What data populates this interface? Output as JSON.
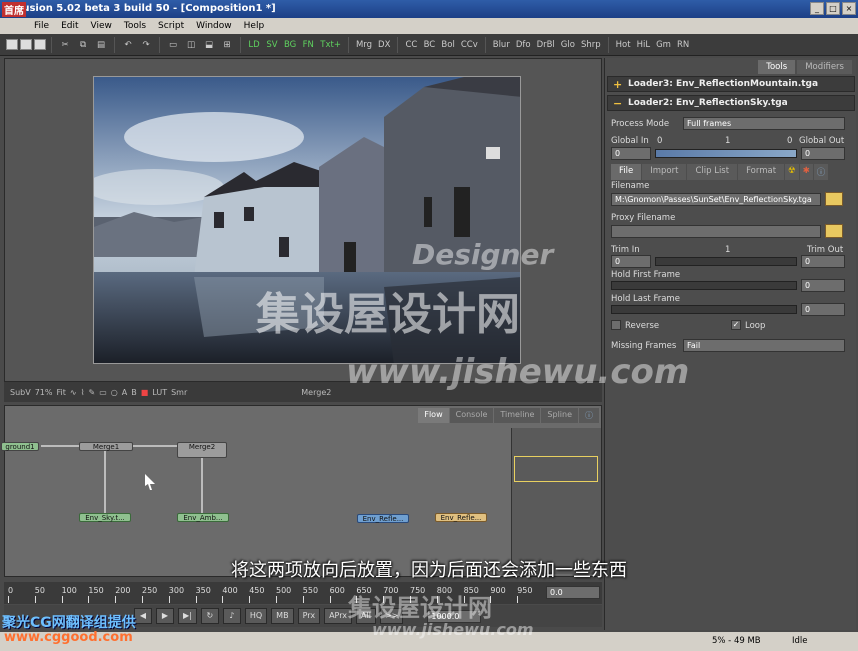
{
  "window": {
    "title": "Fusion 5.02 beta 3 build 50 - [Composition1 *]",
    "logo": "首席"
  },
  "menu": [
    "File",
    "Edit",
    "View",
    "Tools",
    "Script",
    "Window",
    "Help"
  ],
  "toolbar": {
    "green": [
      "LD",
      "SV",
      "BG",
      "FN",
      "Txt+"
    ],
    "tools": [
      "Mrg",
      "DX",
      "CC",
      "BC",
      "Bol",
      "CCv",
      "Blur",
      "Dfo",
      "DrBl",
      "Glo",
      "Shrp",
      "Hot",
      "HiL",
      "Gm",
      "RN"
    ]
  },
  "viewer": {
    "sub": "SubV",
    "zoom": "71%",
    "fit": "Fit",
    "lut": "LUT",
    "smr": "Smr",
    "node_name": "Merge2"
  },
  "flow": {
    "tabs": [
      "Flow",
      "Console",
      "Timeline",
      "Spline"
    ],
    "nodes": {
      "background": "ground1",
      "merge1": "Merge1",
      "merge2": "Merge2",
      "loader_sky": "Env_Sky.t...",
      "loader_amb": "Env_Amb...",
      "loader_ref1": "Env_Refle...",
      "loader_ref2": "Env_Refle..."
    }
  },
  "timeline": {
    "ticks": [
      "0",
      "50",
      "100",
      "150",
      "200",
      "250",
      "300",
      "350",
      "400",
      "450",
      "500",
      "550",
      "600",
      "650",
      "700",
      "750",
      "800",
      "850",
      "900",
      "950"
    ],
    "start": "0.0",
    "end": "1000.0"
  },
  "transport": {
    "hq": "HQ",
    "mb": "MB",
    "prx": "Prx",
    "aprx": "APrx",
    "all": "All",
    "step": ">>"
  },
  "status": {
    "mem": "5% - 49 MB",
    "state": "Idle"
  },
  "panel": {
    "tabs": [
      "Tools",
      "Modifiers"
    ],
    "loader3": "Loader3: Env_ReflectionMountain.tga",
    "loader2": "Loader2: Env_ReflectionSky.tga",
    "process_mode_label": "Process Mode",
    "process_mode": "Full frames",
    "global_in": "Global In",
    "global_out": "Global Out",
    "gi_val": "0",
    "go_val": "0",
    "gi_min": "0",
    "gi_mid": "1",
    "gi_max": "0",
    "subtabs": [
      "File",
      "Import",
      "Clip List",
      "Format"
    ],
    "filename_label": "Filename",
    "filename": "M:\\Gnomon\\Passes\\SunSet\\Env_ReflectionSky.tga",
    "proxy_label": "Proxy Filename",
    "trim_in": "Trim In",
    "trim_out": "Trim Out",
    "trim_mid": "1",
    "ti_val": "0",
    "to_val": "0",
    "hold_first": "Hold First Frame",
    "hold_last": "Hold Last Frame",
    "hf_val": "0",
    "hl_val": "0",
    "reverse": "Reverse",
    "loop": "Loop",
    "missing_label": "Missing Frames",
    "missing": "Fail"
  },
  "subtitle": "将这两项放向后放置，因为后面还会添加一些东西",
  "watermarks": {
    "designer": "Designer",
    "site_cn": "集设屋设计网",
    "site_url": "www.jishewu.com",
    "cg_cn": "聚光CG网翻译组提供",
    "cg_url": "www.cggood.com"
  }
}
